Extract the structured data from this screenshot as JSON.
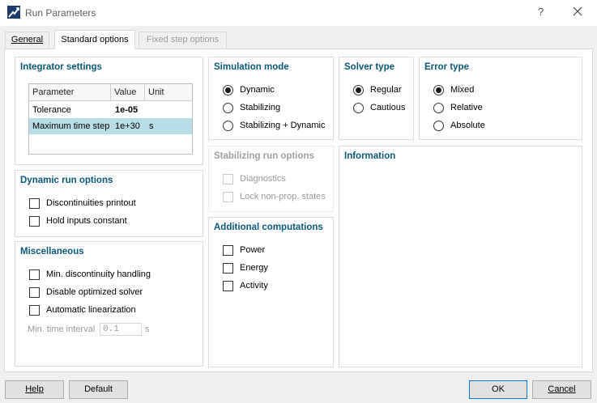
{
  "window": {
    "title": "Run Parameters",
    "help_glyph": "?",
    "app_icon": "run-parameters-icon",
    "close_icon": "close-icon"
  },
  "tabs": [
    {
      "label": "General",
      "state": "normal"
    },
    {
      "label": "Standard options",
      "state": "active"
    },
    {
      "label": "Fixed step options",
      "state": "disabled"
    }
  ],
  "integrator": {
    "title": "Integrator settings",
    "columns": [
      "Parameter",
      "Value",
      "Unit"
    ],
    "rows": [
      {
        "parameter": "Tolerance",
        "value": "1e-05",
        "unit": ""
      },
      {
        "parameter": "Maximum time step",
        "value": "1e+30",
        "unit": "s"
      }
    ]
  },
  "dynamic_run_options": {
    "title": "Dynamic run options",
    "items": [
      {
        "label": "Discontinuities printout",
        "checked": false
      },
      {
        "label": "Hold inputs constant",
        "checked": false
      }
    ]
  },
  "miscellaneous": {
    "title": "Miscellaneous",
    "items": [
      {
        "label": "Min. discontinuity handling",
        "checked": false
      },
      {
        "label": "Disable optimized solver",
        "checked": false
      },
      {
        "label": "Automatic linearization",
        "checked": false
      }
    ],
    "min_time_label": "Min. time interval",
    "min_time_value": "0.1",
    "min_time_unit": "s"
  },
  "simulation_mode": {
    "title": "Simulation mode",
    "options": [
      "Dynamic",
      "Stabilizing",
      "Stabilizing + Dynamic"
    ],
    "selected": "Dynamic"
  },
  "stabilizing_run_options": {
    "title": "Stabilizing run options",
    "items": [
      {
        "label": "Diagnostics",
        "checked": false
      },
      {
        "label": "Lock non-prop. states",
        "checked": false
      }
    ]
  },
  "additional_computations": {
    "title": "Additional computations",
    "items": [
      {
        "label": "Power",
        "checked": false
      },
      {
        "label": "Energy",
        "checked": false
      },
      {
        "label": "Activity",
        "checked": false
      }
    ]
  },
  "solver_type": {
    "title": "Solver type",
    "options": [
      "Regular",
      "Cautious"
    ],
    "selected": "Regular"
  },
  "error_type": {
    "title": "Error type",
    "options": [
      "Mixed",
      "Relative",
      "Absolute"
    ],
    "selected": "Mixed"
  },
  "information": {
    "title": "Information"
  },
  "buttons": {
    "help": "Help",
    "default": "Default",
    "ok": "OK",
    "cancel": "Cancel"
  },
  "colors": {
    "group_title": "#0a5a7a",
    "selected_row": "#b7dde8",
    "disabled_text": "#9a9a9a",
    "primary_border": "#0078d7"
  }
}
